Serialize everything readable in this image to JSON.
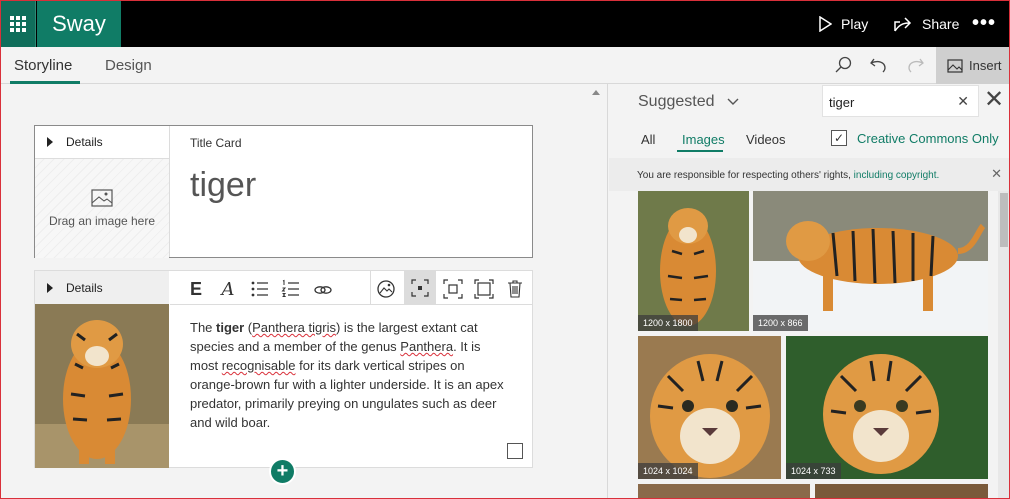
{
  "app": {
    "name": "Sway",
    "actions": {
      "play": "Play",
      "share": "Share",
      "more": "•••"
    }
  },
  "tabs": {
    "storyline": "Storyline",
    "design": "Design",
    "insert": "Insert"
  },
  "storyline": {
    "title_card": {
      "details_label": "Details",
      "drop_hint": "Drag an image here",
      "card_type": "Title Card",
      "title": "tiger"
    },
    "text_card": {
      "details_label": "Details",
      "toolbar": [
        "emphasis-button",
        "accent-button",
        "bullet-list-button",
        "numbered-list-button",
        "link-button",
        "focus-point-button",
        "size-small-button",
        "size-medium-button",
        "size-large-button",
        "delete-button"
      ],
      "text": {
        "p1": "The ",
        "bold": "tiger",
        "p2": " (",
        "sci": "Panthera tigris",
        "p3": ") is the largest extant cat species and a member of the genus ",
        "genus": "Panthera",
        "p4": ". It is most ",
        "recog": "recognisable",
        "p5": " for its dark vertical stripes on orange-brown fur with a lighter underside. It is an apex predator, primarily preying on ungulates such as deer and wild boar."
      }
    },
    "add_button": "+"
  },
  "insert_panel": {
    "source": "Suggested",
    "search_value": "tiger",
    "tabs": [
      "All",
      "Images",
      "Videos"
    ],
    "active_tab": "Images",
    "creative_commons": "Creative Commons Only",
    "creative_commons_checked": true,
    "notice": "You are responsible for respecting others' rights, ",
    "notice_link": "including copyright.",
    "results": [
      {
        "dimensions": "1200 x 1800"
      },
      {
        "dimensions": "1200 x 866"
      },
      {
        "dimensions": "1024 x 1024"
      },
      {
        "dimensions": "1024 x 733"
      }
    ]
  },
  "colors": {
    "brand": "#107c66",
    "brand_dark": "#106e5b",
    "topbar": "#000000"
  }
}
